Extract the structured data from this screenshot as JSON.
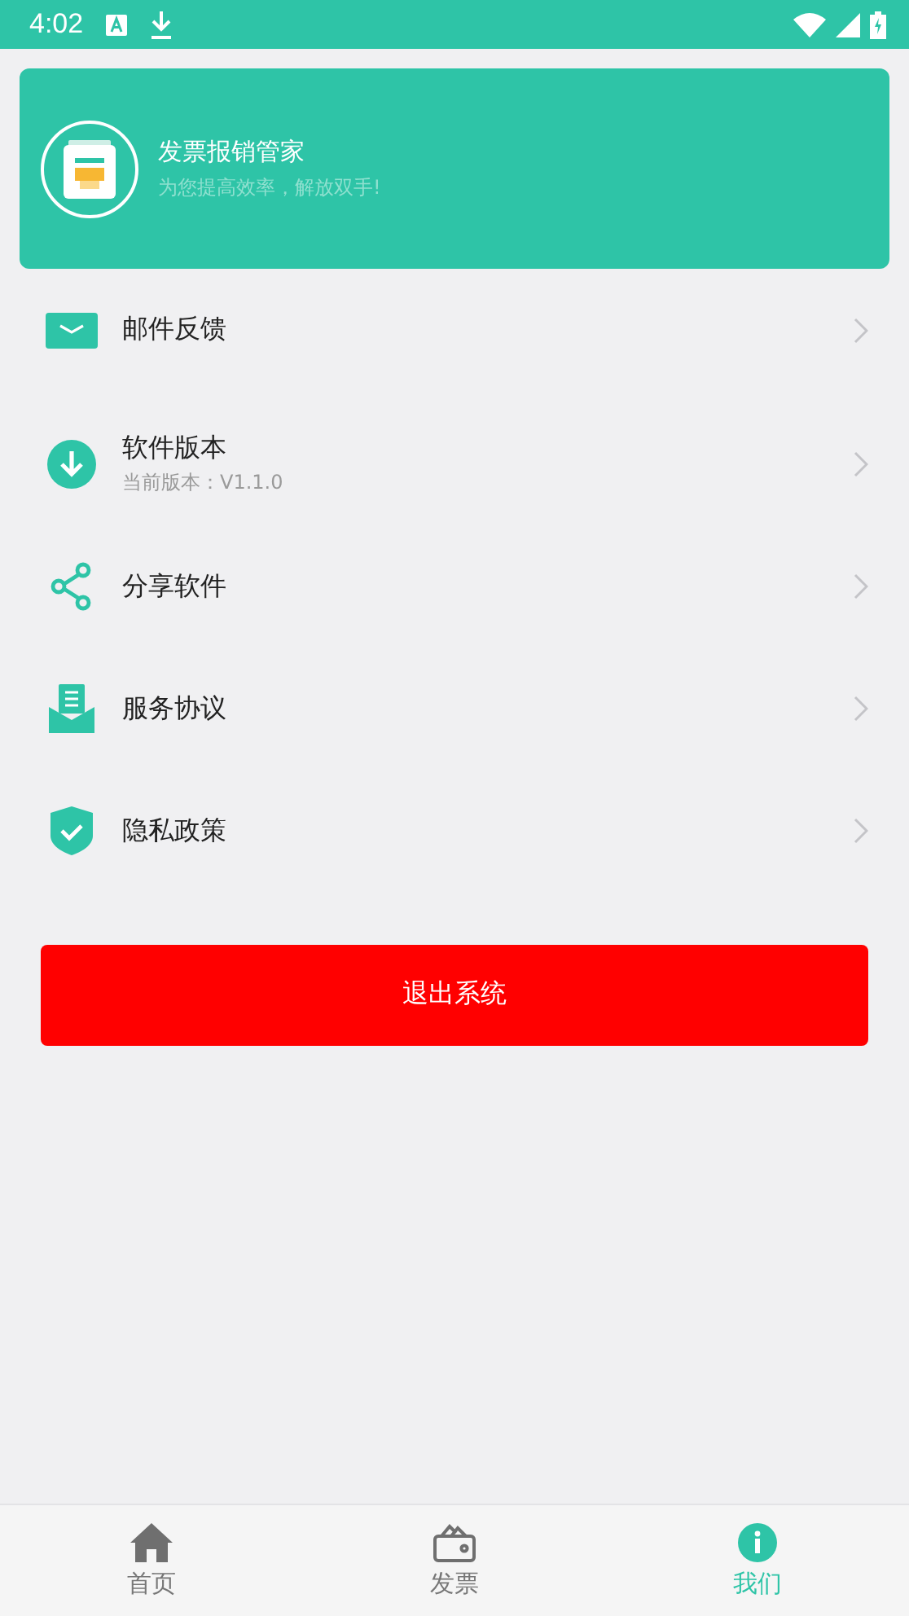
{
  "status_bar": {
    "time": "4:02"
  },
  "header": {
    "title": "发票报销管家",
    "subtitle": "为您提高效率，解放双手!"
  },
  "menu": [
    {
      "title": "邮件反馈"
    },
    {
      "title": "软件版本",
      "subtitle": "当前版本：V1.1.0"
    },
    {
      "title": "分享软件"
    },
    {
      "title": "服务协议"
    },
    {
      "title": "隐私政策"
    }
  ],
  "logout_button": "退出系统",
  "bottom_nav": [
    {
      "label": "首页",
      "selected": false
    },
    {
      "label": "发票",
      "selected": false
    },
    {
      "label": "我们",
      "selected": true
    }
  ]
}
